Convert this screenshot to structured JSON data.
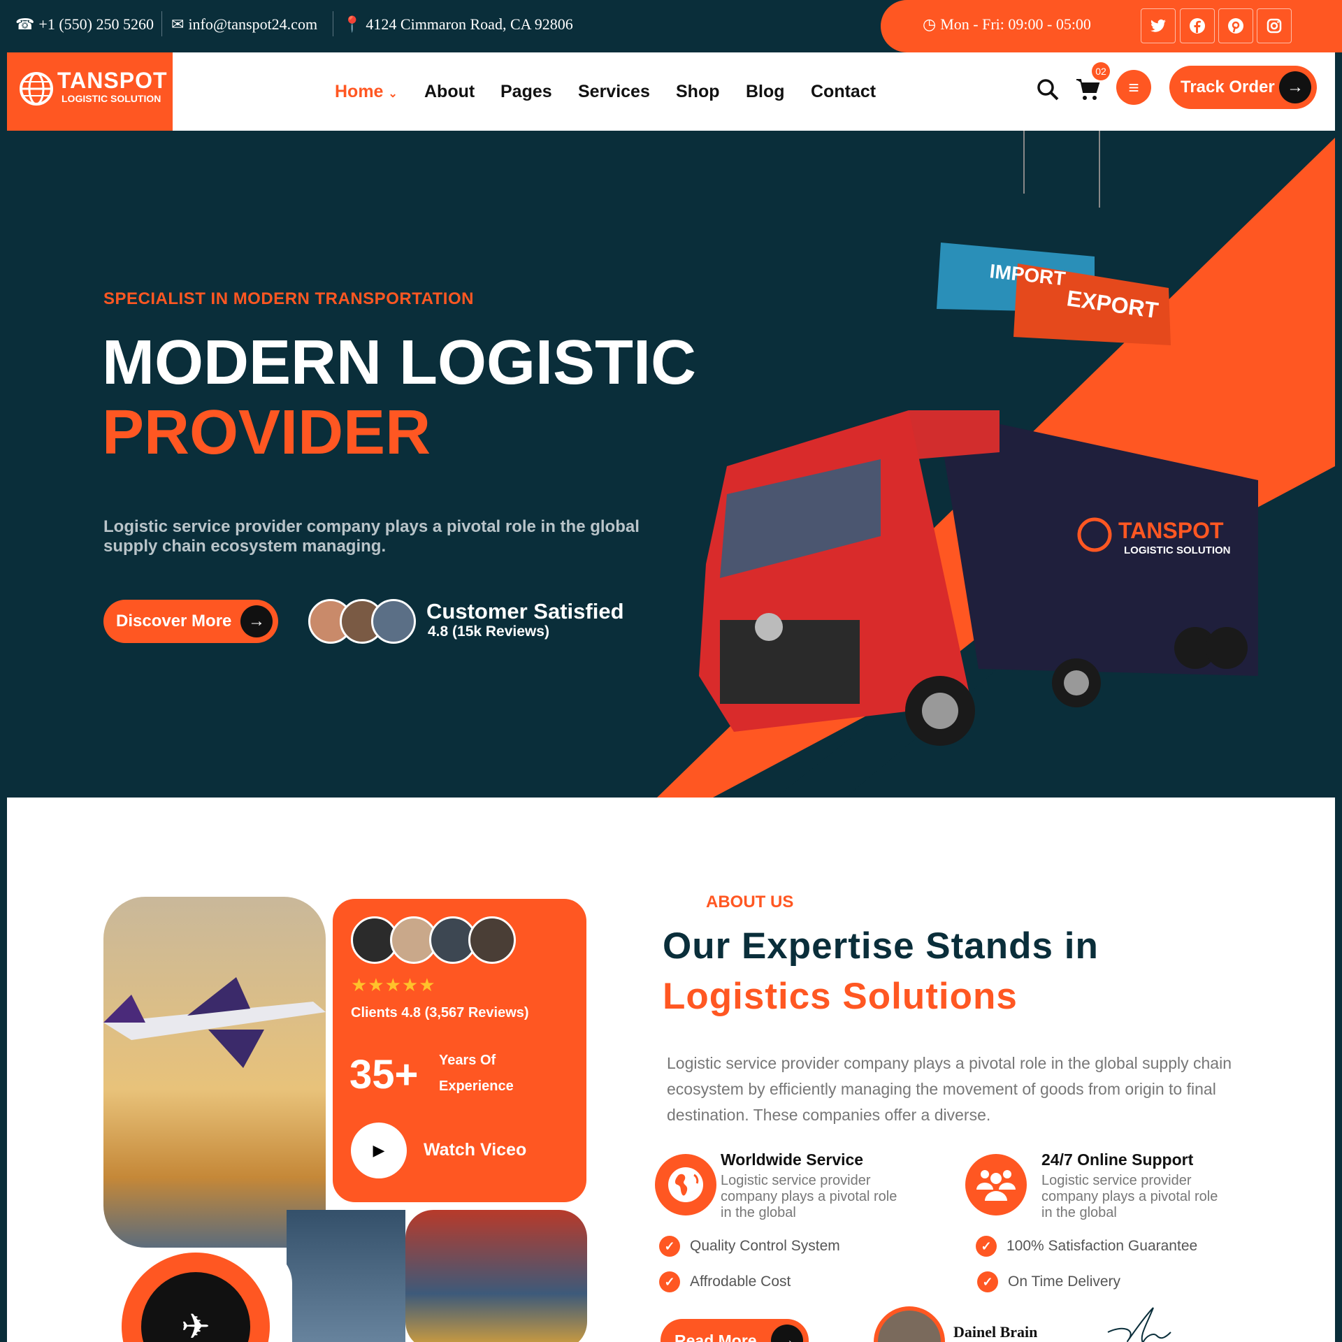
{
  "topbar": {
    "phone": "+1 (550) 250 5260",
    "email": "info@tanspot24.com",
    "address": "4124 Cimmaron Road, CA 92806",
    "hours": "Mon - Fri: 09:00 - 05:00",
    "social": [
      "twitter-icon",
      "facebook-icon",
      "pinterest-icon",
      "instagram-icon"
    ]
  },
  "logo": {
    "name": "TANSPOT",
    "tagline": "LOGISTIC SOLUTION"
  },
  "nav": {
    "items": [
      "Home",
      "About",
      "Pages",
      "Services",
      "Shop",
      "Blog",
      "Contact"
    ],
    "active": "Home",
    "cart_count": "02",
    "track_label": "Track Order"
  },
  "hero": {
    "eyebrow": "SPECIALIST IN MODERN TRANSPORTATION",
    "title_line1": "MODERN LOGISTIC",
    "title_line2": "PROVIDER",
    "description": "Logistic service provider company plays a pivotal role in the global supply chain ecosystem managing.",
    "cta": "Discover More",
    "satisfied_title": "Customer Satisfied",
    "satisfied_rating": "4.8 (15k Reviews)",
    "container_import": "IMPORT",
    "container_export": "EXPORT",
    "truck_logo_name": "TANSPOT",
    "truck_logo_tagline": "LOGISTIC SOLUTION"
  },
  "about": {
    "card": {
      "rating": "Clients 4.8 (3,567 Reviews)",
      "years": "35+",
      "years_label1": "Years Of",
      "years_label2": "Experience",
      "video": "Watch Viceo",
      "stars": 5
    },
    "eyebrow": "ABOUT US",
    "title_line1": "Our Expertise Stands in",
    "title_line2": "Logistics Solutions",
    "description": "Logistic service provider company plays a pivotal role in the global supply chain ecosystem by efficiently managing the movement of goods from origin to final destination. These companies offer a diverse.",
    "features": [
      {
        "title": "Worldwide Service",
        "text": "Logistic service provider company plays a pivotal role in the global"
      },
      {
        "title": "24/7 Online Support",
        "text": "Logistic service provider company plays a pivotal role in the global"
      }
    ],
    "checklist": [
      "Quality Control System",
      "100% Satisfaction Guarantee",
      "Affrodable Cost",
      "On Time Delivery"
    ],
    "read_more": "Read More",
    "author": "Dainel Brain"
  },
  "colors": {
    "accent": "#ff5722",
    "dark": "#0a2e3a"
  }
}
